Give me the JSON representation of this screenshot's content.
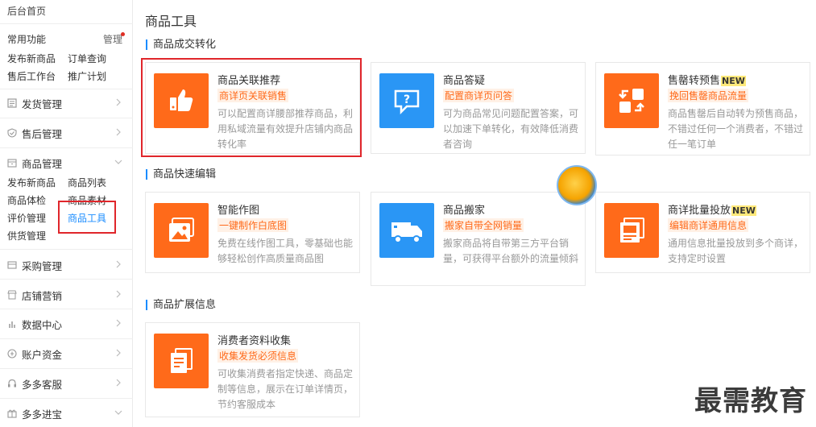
{
  "sidebar": {
    "home": "后台首页",
    "common": {
      "title": "常用功能",
      "manage": "管理",
      "links": [
        "发布新商品",
        "订单查询",
        "售后工作台",
        "推广计划"
      ]
    },
    "groups": [
      {
        "label": "发货管理",
        "icon": "list-icon"
      },
      {
        "label": "售后管理",
        "icon": "shield-check-icon"
      },
      {
        "label": "商品管理",
        "icon": "box-icon"
      },
      {
        "label": "采购管理",
        "icon": "cart-icon"
      },
      {
        "label": "店铺营销",
        "icon": "store-icon"
      },
      {
        "label": "数据中心",
        "icon": "bar-chart-icon"
      },
      {
        "label": "账户资金",
        "icon": "wallet-icon"
      },
      {
        "label": "多多客服",
        "icon": "headset-icon"
      },
      {
        "label": "多多进宝",
        "icon": "gift-icon"
      }
    ],
    "goods_links": [
      "发布新商品",
      "商品列表",
      "商品体检",
      "商品素材",
      "评价管理",
      "商品工具",
      "供货管理"
    ]
  },
  "main": {
    "title": "商品工具",
    "sections": [
      {
        "title": "商品成交转化",
        "cards": [
          {
            "name": "商品关联推荐",
            "tag": "商详页关联销售",
            "desc": "可以配置商详腰部推荐商品，利用私域流量有效提升店铺内商品转化率",
            "new": ""
          },
          {
            "name": "商品答疑",
            "tag": "配置商详页问答",
            "desc": "可为商品常见问题配置答案，可以加速下单转化，有效降低消费者咨询",
            "new": ""
          },
          {
            "name": "售罄转预售",
            "tag": "挽回售罄商品流量",
            "desc": "商品售罄后自动转为预售商品，不错过任何一个消费者，不错过任一笔订单",
            "new": "NEW"
          }
        ]
      },
      {
        "title": "商品快速编辑",
        "cards": [
          {
            "name": "智能作图",
            "tag": "一键制作白底图",
            "desc": "免费在线作图工具，零基础也能够轻松创作高质量商品图",
            "new": ""
          },
          {
            "name": "商品搬家",
            "tag": "搬家自带全网销量",
            "desc": "搬家商品将自带第三方平台销量，可获得平台额外的流量倾斜",
            "new": ""
          },
          {
            "name": "商详批量投放",
            "tag": "编辑商详通用信息",
            "desc": "通用信息批量投放到多个商详，支持定时设置",
            "new": "NEW"
          }
        ]
      },
      {
        "title": "商品扩展信息",
        "cards": [
          {
            "name": "消费者资料收集",
            "tag": "收集发货必须信息",
            "desc": "可收集消费者指定快递、商品定制等信息，展示在订单详情页，节约客服成本",
            "new": ""
          }
        ]
      }
    ]
  },
  "watermark": "最需教育",
  "colors": {
    "accent": "#1a8cff",
    "orange": "#ff6a1a",
    "highlight_box": "#e0262b"
  }
}
